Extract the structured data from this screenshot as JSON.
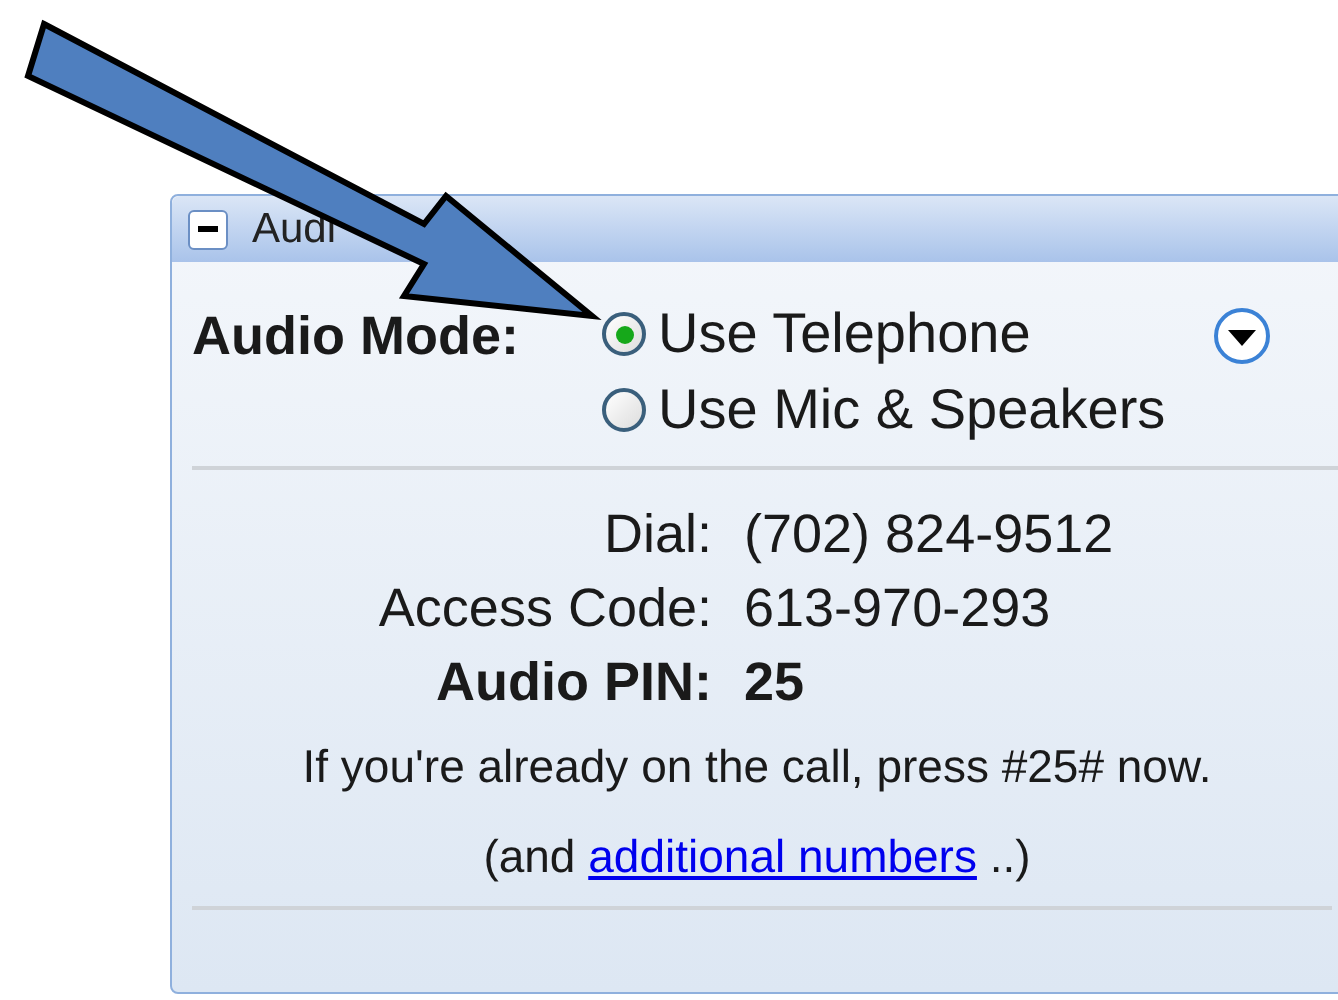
{
  "panel": {
    "title": "Audi",
    "expanded": true
  },
  "audio_mode": {
    "label": "Audio Mode:",
    "options": [
      {
        "label": "Use Telephone",
        "selected": true
      },
      {
        "label": "Use Mic & Speakers",
        "selected": false
      }
    ]
  },
  "details": [
    {
      "label": "Dial:",
      "value": "(702) 824-9512",
      "emphasis": false
    },
    {
      "label": "Access Code:",
      "value": "613-970-293",
      "emphasis": false
    },
    {
      "label": "Audio PIN:",
      "value": "25",
      "emphasis": true
    }
  ],
  "note": "If you're already on the call, press #25# now.",
  "more": {
    "prefix": "(and",
    "link": "additional numbers",
    "suffix": "..)"
  }
}
